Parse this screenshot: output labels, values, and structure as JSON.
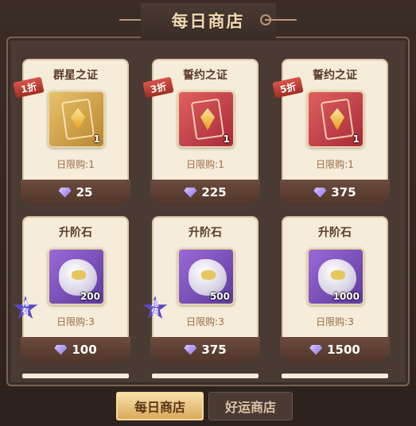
{
  "header": {
    "title": "每日商店"
  },
  "cards": [
    {
      "name": "群星之证",
      "discount": "1折",
      "count": "1",
      "limit": "日限购:1",
      "price": "25",
      "item": "gold-card-item",
      "style": "gold"
    },
    {
      "name": "誓约之证",
      "discount": "3折",
      "count": "1",
      "limit": "日限购:1",
      "price": "225",
      "item": "red-card-item",
      "style": "red"
    },
    {
      "name": "誓约之证",
      "discount": "5折",
      "count": "1",
      "limit": "日限购:1",
      "price": "375",
      "item": "red-card-item",
      "style": "red"
    },
    {
      "name": "升阶石",
      "badge": "稀有",
      "count": "200",
      "limit": "日限购:3",
      "price": "100",
      "item": "ascension-stone",
      "style": "purple"
    },
    {
      "name": "升阶石",
      "badge": "超值",
      "count": "500",
      "limit": "日限购:3",
      "price": "375",
      "item": "ascension-stone",
      "style": "purple"
    },
    {
      "name": "升阶石",
      "count": "1000",
      "limit": "日限购:3",
      "price": "1500",
      "item": "ascension-stone",
      "style": "purple"
    }
  ],
  "tabs": [
    {
      "label": "每日商店",
      "active": true
    },
    {
      "label": "好运商店",
      "active": false
    }
  ],
  "colors": {
    "accent": "#f1d9b0",
    "card_bg": "#f5ecd9",
    "discount_red": "#c0392b",
    "gem": "#8e72e8"
  }
}
